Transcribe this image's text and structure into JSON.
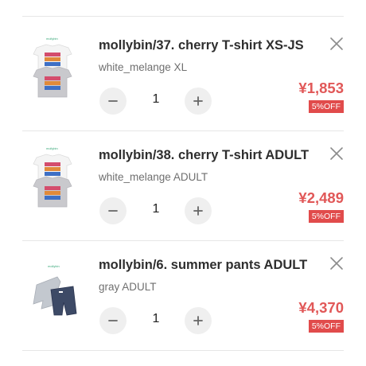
{
  "cart": {
    "items": [
      {
        "title": "mollybin/37. cherry T-shirt XS-JS",
        "variant": "white_melange XL",
        "quantity": "1",
        "price": "¥1,853",
        "discount": "5%OFF",
        "thumbnail": "tshirt-pair-image"
      },
      {
        "title": "mollybin/38. cherry T-shirt ADULT",
        "variant": "white_melange ADULT",
        "quantity": "1",
        "price": "¥2,489",
        "discount": "5%OFF",
        "thumbnail": "tshirt-pair-image"
      },
      {
        "title": "mollybin/6. summer pants ADULT",
        "variant": "gray ADULT",
        "quantity": "1",
        "price": "¥4,370",
        "discount": "5%OFF",
        "thumbnail": "pants-pair-image"
      }
    ],
    "icons": {
      "remove": "close-icon",
      "decrease": "minus-icon",
      "increase": "plus-icon"
    },
    "colors": {
      "price": "#e15858",
      "badge": "#e14b4b",
      "stepper_bg": "#efefef"
    }
  }
}
